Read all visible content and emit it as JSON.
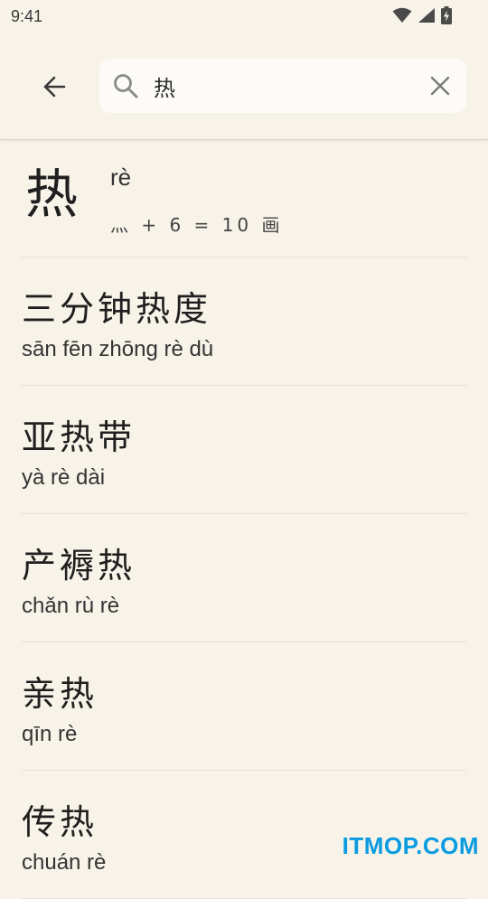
{
  "status_bar": {
    "time": "9:41"
  },
  "search": {
    "value": "热"
  },
  "character": {
    "glyph": "热",
    "pinyin": "rè",
    "strokes": "灬 + 6 = 10 画"
  },
  "words": [
    {
      "hanzi": "三分钟热度",
      "pinyin": "sān fēn zhōng rè dù"
    },
    {
      "hanzi": "亚热带",
      "pinyin": "yà rè dài"
    },
    {
      "hanzi": "产褥热",
      "pinyin": "chǎn rù rè"
    },
    {
      "hanzi": "亲热",
      "pinyin": "qīn rè"
    },
    {
      "hanzi": "传热",
      "pinyin": "chuán rè"
    }
  ],
  "watermark": "ITMOP.COM",
  "colors": {
    "background": "#f7f3e9",
    "search_box": "#fdfbf7",
    "watermark": "#0a9be0"
  }
}
